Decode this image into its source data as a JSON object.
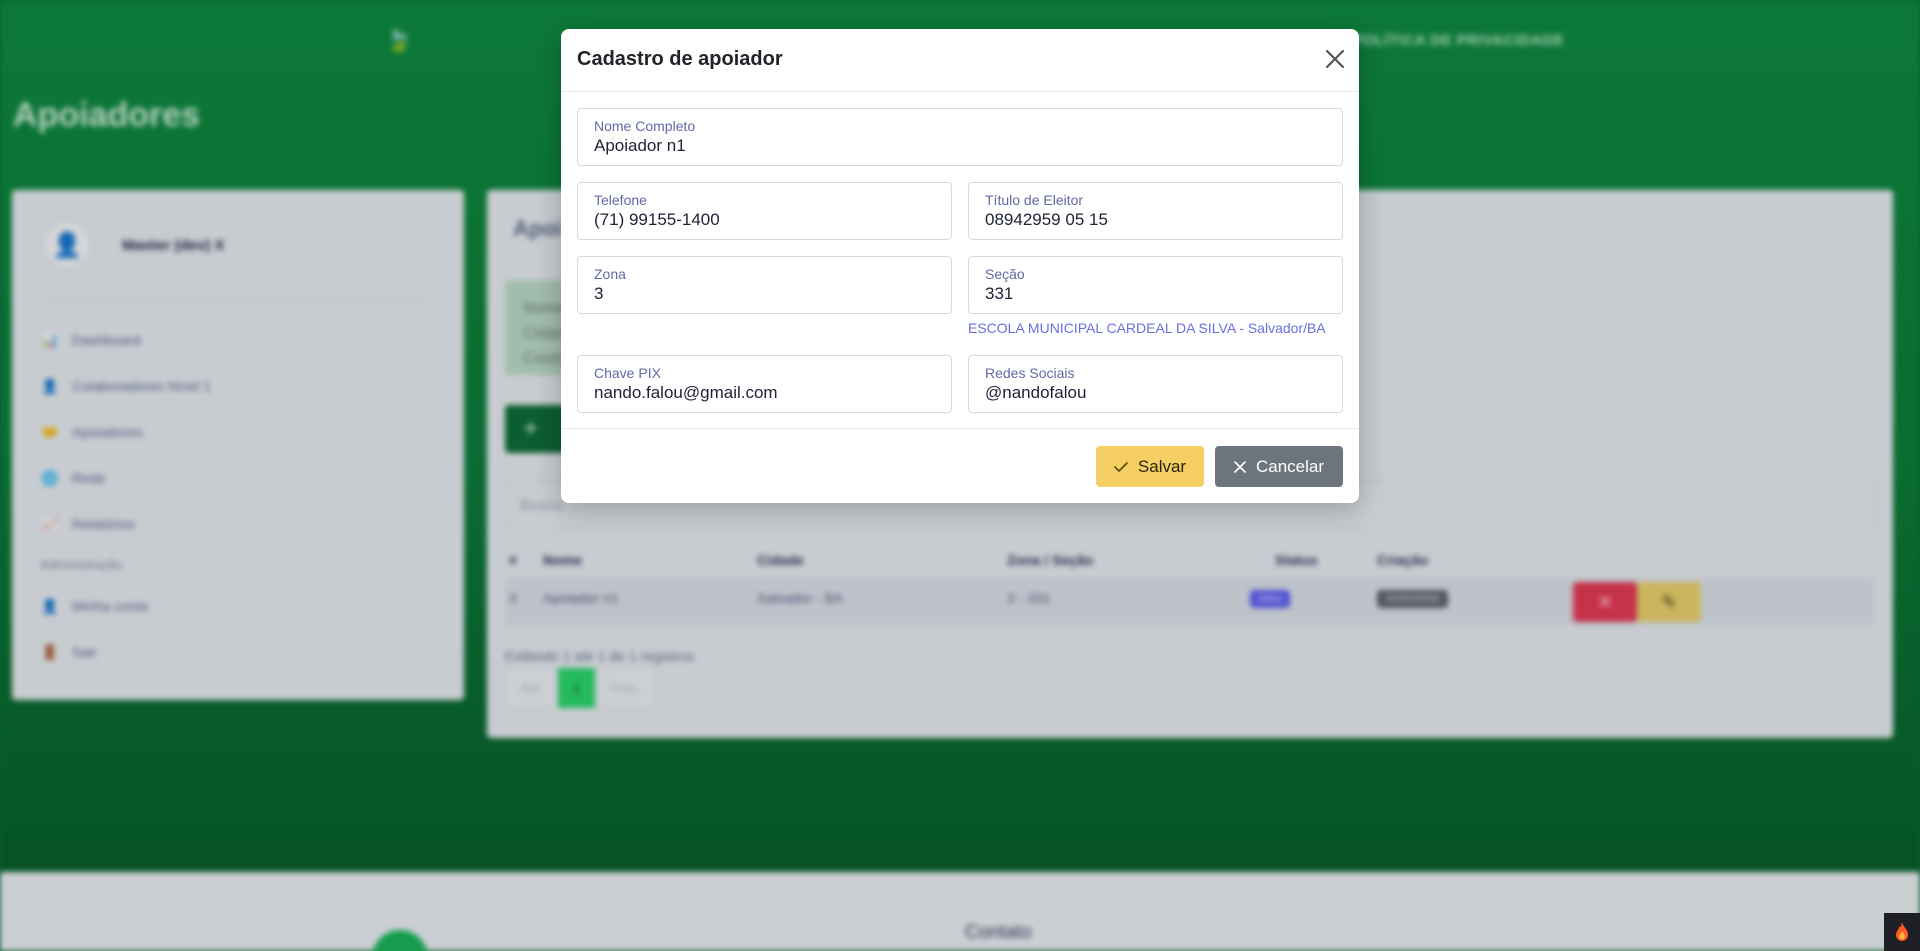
{
  "background": {
    "nav": {
      "logo_icon": "leaf-icon",
      "privacy_link": "POLÍTICA DE PRIVACIDADE"
    },
    "page_title": "Apoiadores",
    "sidebar": {
      "user_name": "Master (dev) X",
      "items": [
        {
          "label": "Dashboard",
          "icon": "chart-icon"
        },
        {
          "label": "Colaboradores Nível 1",
          "icon": "person-icon"
        },
        {
          "label": "Apoiadores",
          "icon": "handshake-icon"
        },
        {
          "label": "Rede",
          "icon": "globe-icon"
        },
        {
          "label": "Relatórios",
          "icon": "report-icon"
        }
      ],
      "admin_section": "Administração",
      "admin_items": [
        {
          "label": "Minha conta",
          "icon": "person-icon"
        },
        {
          "label": "Sair",
          "icon": "door-icon"
        }
      ]
    },
    "main": {
      "title": "Apoi",
      "info_lines": [
        "Nome",
        "Cidad",
        "Coord"
      ],
      "add_button": "+",
      "search_placeholder": "Busca",
      "table": {
        "headers": [
          "#",
          "Nome",
          "Cidade",
          "Zona / Seção",
          "Status",
          "Criação"
        ],
        "rows": [
          {
            "id": "3",
            "nome": "Apoiador n1",
            "cidade": "Salvador - BA",
            "zona_secao": "3 - 331",
            "status": "Ativo",
            "criacao": "00/00/0000"
          }
        ]
      },
      "showing": "Exibindo 1 até 1 de 1 registros",
      "pager": [
        "Ant.",
        "1",
        "Próx."
      ]
    },
    "footer": {
      "contact_title": "Contato"
    }
  },
  "modal": {
    "title": "Cadastro de apoiador",
    "close_icon": "close-icon",
    "fields": {
      "nome": {
        "label": "Nome Completo",
        "value": "Apoiador n1"
      },
      "telefone": {
        "label": "Telefone",
        "value": "(71) 99155-1400"
      },
      "titulo": {
        "label": "Título de Eleitor",
        "value": "08942959 05 15"
      },
      "zona": {
        "label": "Zona",
        "value": "3"
      },
      "secao": {
        "label": "Seção",
        "value": "331"
      },
      "pix": {
        "label": "Chave PIX",
        "value": "nando.falou@gmail.com"
      },
      "redes": {
        "label": "Redes Sociais",
        "value": "@nandofalou"
      }
    },
    "escola": "ESCOLA MUNICIPAL CARDEAL DA SILVA - Salvador/BA",
    "buttons": {
      "save": "Salvar",
      "cancel": "Cancelar"
    }
  },
  "colors": {
    "brand_green": "#0c7a38",
    "save_yellow": "#f5cf63",
    "cancel_gray": "#6c757d",
    "label_purple": "#6268a6",
    "link_blue": "#6a6ee0"
  }
}
